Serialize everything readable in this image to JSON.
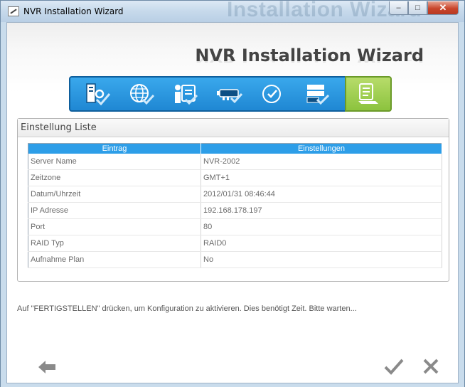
{
  "window": {
    "title": "NVR Installation Wizard",
    "ghost_title": "Installation Wizard",
    "buttons": {
      "minimize": "–",
      "maximize": "□",
      "close": "✕"
    }
  },
  "header": {
    "wizard_title": "NVR Installation Wizard"
  },
  "steps": [
    {
      "icon": "server-settings-icon",
      "state": "done"
    },
    {
      "icon": "globe-icon",
      "state": "done"
    },
    {
      "icon": "user-certificate-icon",
      "state": "done"
    },
    {
      "icon": "network-card-icon",
      "state": "done"
    },
    {
      "icon": "clock-icon",
      "state": "done"
    },
    {
      "icon": "disk-stack-icon",
      "state": "done"
    },
    {
      "icon": "summary-list-icon",
      "state": "active"
    }
  ],
  "panel": {
    "title": "Einstellung Liste",
    "columns": [
      "Eintrag",
      "Einstellungen"
    ],
    "rows": [
      [
        "Server Name",
        "NVR-2002"
      ],
      [
        "Zeitzone",
        "GMT+1"
      ],
      [
        "Datum/Uhrzeit",
        "2012/01/31 08:46:44"
      ],
      [
        "IP Adresse",
        "192.168.178.197"
      ],
      [
        "Port",
        "80"
      ],
      [
        "RAID Typ",
        "RAID0"
      ],
      [
        "Aufnahme Plan",
        "No"
      ]
    ]
  },
  "message": "Auf \"FERTIGSTELLEN\" drücken, um Konfiguration zu aktivieren. Dies benötigt Zeit. Bitte warten...",
  "colors": {
    "accent_blue": "#2d9ee8",
    "step_green": "#8cc33e",
    "nav_gray": "#8a8a8a"
  }
}
